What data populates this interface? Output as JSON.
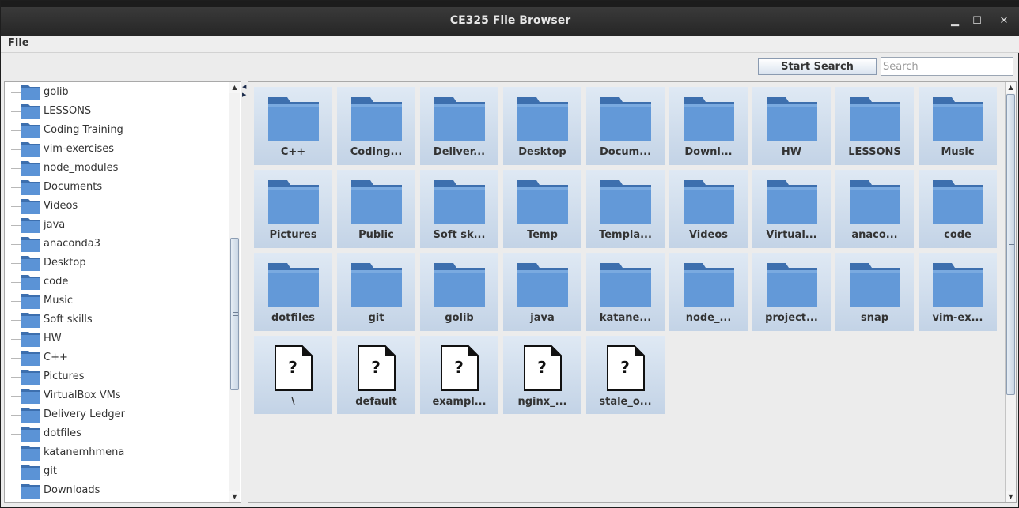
{
  "window": {
    "title": "CE325 File Browser",
    "minimize": "▁",
    "maximize": "☐",
    "close": "✕"
  },
  "menubar": {
    "file_label": "File"
  },
  "toolbar": {
    "start_search_label": "Start Search",
    "search_placeholder": "Search"
  },
  "tree": {
    "items": [
      "golib",
      "LESSONS",
      "Coding Training",
      "vim-exercises",
      "node_modules",
      "Documents",
      "Videos",
      "java",
      "anaconda3",
      "Desktop",
      "code",
      "Music",
      "Soft skills",
      "HW",
      "C++",
      "Pictures",
      "VirtualBox VMs",
      "Delivery Ledger",
      "dotfiles",
      "katanemhmena",
      "git",
      "Downloads"
    ]
  },
  "grid": {
    "folders": [
      "C++",
      "Coding...",
      "Deliver...",
      "Desktop",
      "Docum...",
      "Downl...",
      "HW",
      "LESSONS",
      "Music",
      "Pictures",
      "Public",
      "Soft sk...",
      "Temp",
      "Templa...",
      "Videos",
      "Virtual...",
      "anaco...",
      "code",
      "dotfiles",
      "git",
      "golib",
      "java",
      "katane...",
      "node_...",
      "project...",
      "snap",
      "vim-ex..."
    ],
    "files": [
      "\\",
      "default",
      "exampl...",
      "nginx_...",
      "stale_o..."
    ],
    "file_glyph": "?"
  },
  "icons": {
    "folder": "folder-icon",
    "file": "unknown-file-icon"
  },
  "colors": {
    "folder_body": "#5b93d6",
    "folder_tab": "#3d6fae",
    "tile_top": "#dfe9f4",
    "tile_bottom": "#c3d3e6",
    "titlebar": "#2d2d2d"
  }
}
